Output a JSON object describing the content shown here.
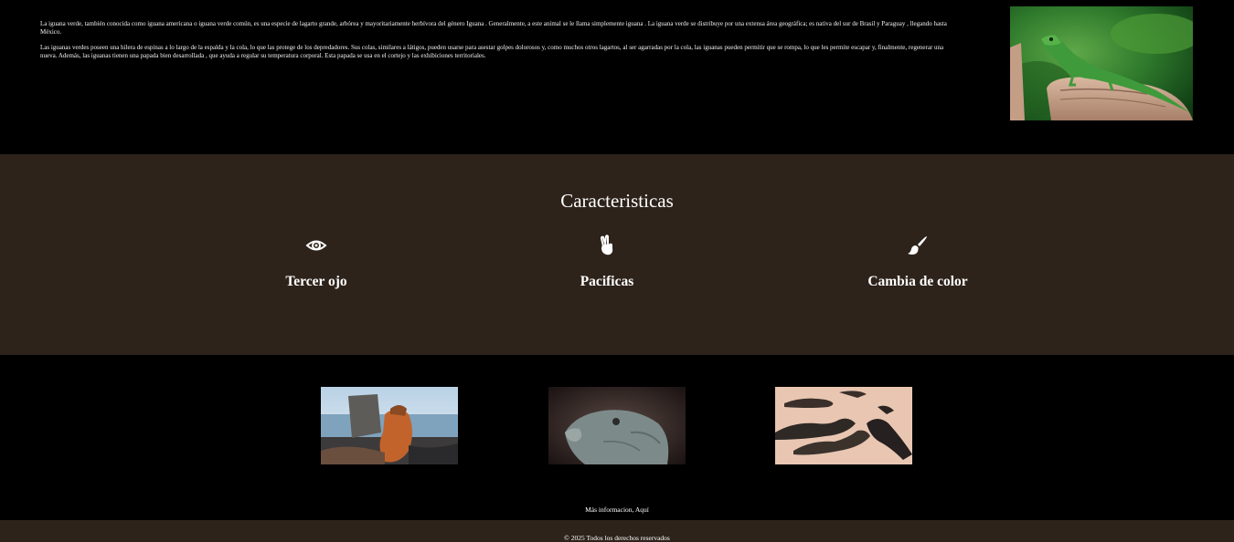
{
  "intro": {
    "paragraph_1": "La iguana verde, también conocida como iguana americana o iguana verde común, es una especie de lagarto grande, arbórea y mayoritariamente herbívora del género Iguana . Generalmente, a este animal se le llama simplemente iguana . La iguana verde se distribuye por una extensa área geográfica; es nativa del sur de Brasil y Paraguay , llegando hasta México.",
    "paragraph_2": "Las iguanas verdes poseen una hilera de espinas a lo largo de la espalda y la cola, lo que las protege de los depredadores. Sus colas, similares a látigos, pueden usarse para asestar golpes dolorosos y, como muchos otros lagartos, al ser agarradas por la cola, las iguanas pueden permitir que se rompa, lo que les permite escapar y, finalmente, regenerar una nueva. Además, las iguanas tienen una papada bien desarrollada , que ayuda a regular su temperatura corporal. Esta papada se usa en el cortejo y las exhibiciones territoriales."
  },
  "features": {
    "title": "Caracteristicas",
    "items": [
      {
        "label": "Tercer ojo",
        "icon": "eye-icon"
      },
      {
        "label": "Pacificas",
        "icon": "peace-hand-icon"
      },
      {
        "label": "Cambia de color",
        "icon": "paintbrush-icon"
      }
    ]
  },
  "gallery": {
    "more_info": "Más informacion, Aquí"
  },
  "footer": {
    "copyright": "© 2025 Todos los derechos reservados"
  },
  "colors": {
    "background": "#000000",
    "band": "#2d231b",
    "text": "#ffffff"
  }
}
